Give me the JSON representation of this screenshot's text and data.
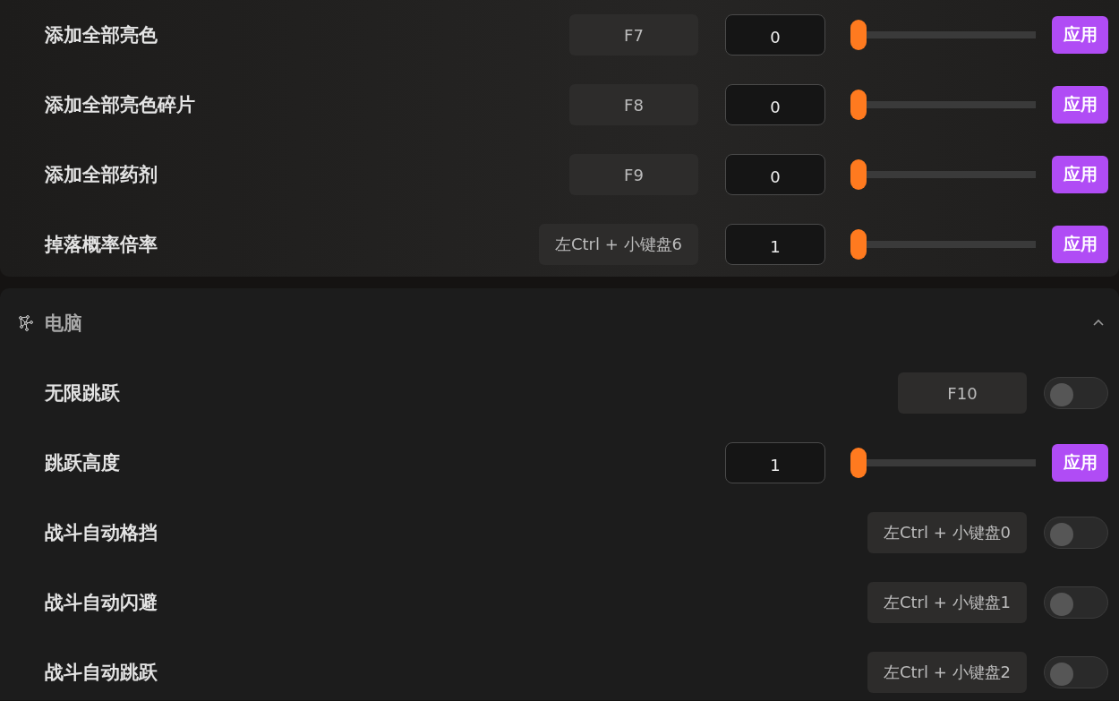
{
  "top_rows": [
    {
      "kind": "slider",
      "label": "添加全部亮色",
      "hotkey": "F7",
      "value": "0",
      "level": 0,
      "apply": "应用"
    },
    {
      "kind": "slider",
      "label": "添加全部亮色碎片",
      "hotkey": "F8",
      "value": "0",
      "level": 0,
      "apply": "应用"
    },
    {
      "kind": "slider",
      "label": "添加全部药剂",
      "hotkey": "F9",
      "value": "0",
      "level": 0,
      "apply": "应用"
    },
    {
      "kind": "slider",
      "label": "掉落概率倍率",
      "hotkey": "左Ctrl + 小键盘6",
      "value": "1",
      "level": 0,
      "apply": "应用"
    }
  ],
  "section": {
    "title": "电脑",
    "expanded": true,
    "rows": [
      {
        "kind": "toggle",
        "label": "无限跳跃",
        "hotkey": "F10",
        "on": false
      },
      {
        "kind": "slider",
        "label": "跳跃高度",
        "value": "1",
        "level": 0,
        "apply": "应用"
      },
      {
        "kind": "toggle",
        "label": "战斗自动格挡",
        "hotkey": "左Ctrl + 小键盘0",
        "on": false
      },
      {
        "kind": "toggle",
        "label": "战斗自动闪避",
        "hotkey": "左Ctrl + 小键盘1",
        "on": false
      },
      {
        "kind": "toggle",
        "label": "战斗自动跳跃",
        "hotkey": "左Ctrl + 小键盘2",
        "on": false
      }
    ]
  }
}
